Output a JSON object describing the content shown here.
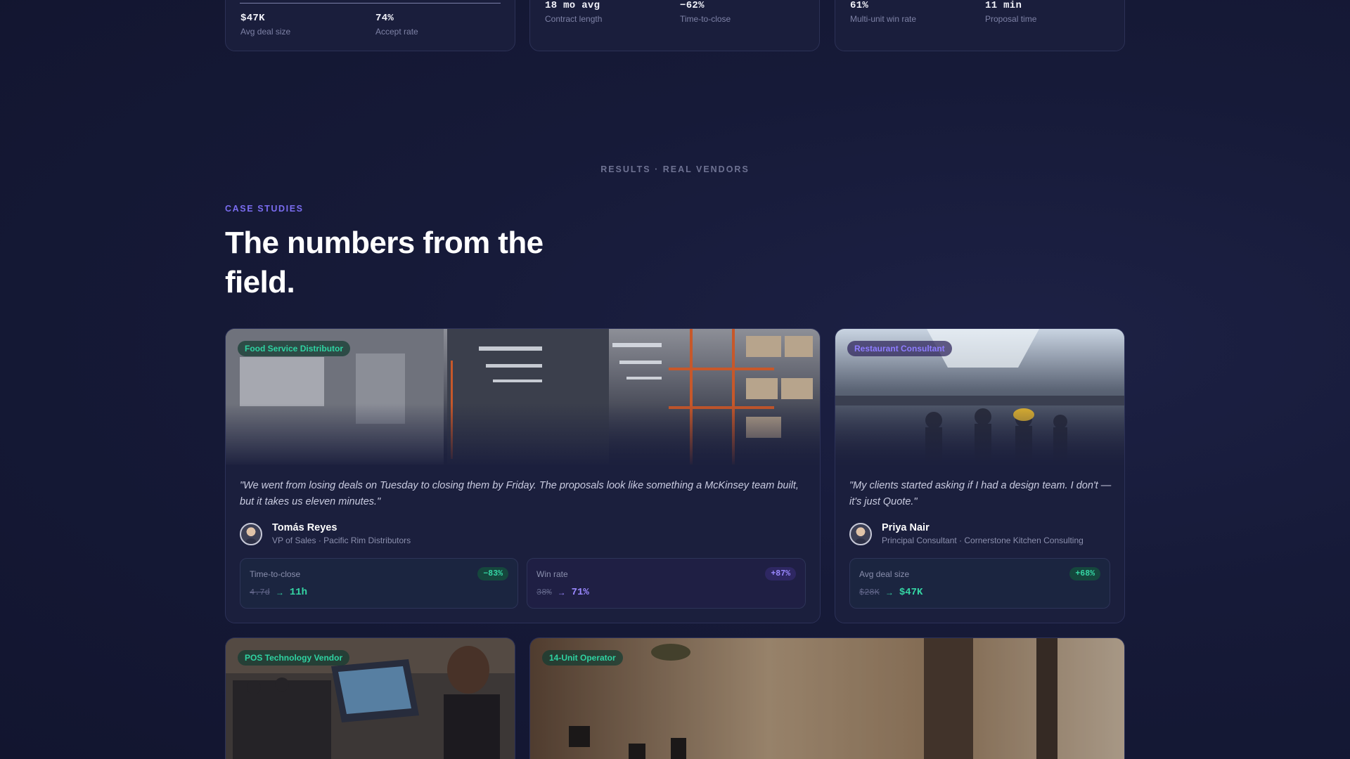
{
  "top_stats": [
    {
      "left": {
        "value": "$47K",
        "label": "Avg deal size"
      },
      "right": {
        "value": "74%",
        "label": "Accept rate"
      }
    },
    {
      "left": {
        "value": "18 mo avg",
        "label": "Contract length"
      },
      "right": {
        "value": "−62%",
        "label": "Time-to-close"
      }
    },
    {
      "left": {
        "value": "61%",
        "label": "Multi-unit win rate"
      },
      "right": {
        "value": "11 min",
        "label": "Proposal time"
      }
    }
  ],
  "results_label": "RESULTS · REAL VENDORS",
  "eyebrow": "CASE STUDIES",
  "headline": "The numbers from the field.",
  "cases": [
    {
      "tag": "Food Service Distributor",
      "quote": "\"We went from losing deals on Tuesday to closing them by Friday. The proposals look like something a McKinsey team built, but it takes us eleven minutes.\"",
      "name": "Tomás Reyes",
      "role": "VP of Sales · Pacific Rim Distributors",
      "metrics": [
        {
          "label": "Time-to-close",
          "badge": "−83%",
          "from": "4.7d",
          "arrow": "→",
          "to": "11h"
        },
        {
          "label": "Win rate",
          "badge": "+87%",
          "from": "38%",
          "arrow": "→",
          "to": "71%"
        }
      ]
    },
    {
      "tag": "Restaurant Consultant",
      "quote": "\"My clients started asking if I had a design team. I don't — it's just Quote.\"",
      "name": "Priya Nair",
      "role": "Principal Consultant · Cornerstone Kitchen Consulting",
      "metrics": [
        {
          "label": "Avg deal size",
          "badge": "+68%",
          "from": "$28K",
          "arrow": "→",
          "to": "$47K"
        }
      ]
    },
    {
      "tag": "POS Technology Vendor"
    },
    {
      "tag": "14-Unit Operator"
    }
  ],
  "colors": {
    "accent_green": "#35d6a4",
    "accent_purple": "#8f7dff",
    "background": "#161a38"
  },
  "icons": [
    "arrow-right-icon",
    "avatar-icon"
  ]
}
